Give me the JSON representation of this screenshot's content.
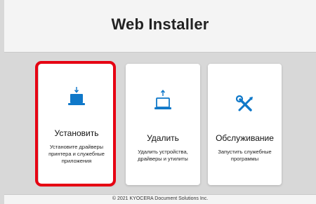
{
  "header": {
    "title": "Web Installer"
  },
  "cards": [
    {
      "title": "Установить",
      "description_lines": [
        "Установите драйверы",
        "принтера и служебные",
        "приложения"
      ],
      "icon": "laptop-download-icon"
    },
    {
      "title": "Удалить",
      "description_lines": [
        "Удалить устройства,",
        "драйверы и утилиты"
      ],
      "icon": "laptop-upload-icon"
    },
    {
      "title": "Обслуживание",
      "description_lines": [
        "Запустить служебные",
        "программы"
      ],
      "icon": "wrench-screwdriver-icon"
    }
  ],
  "selected_card": 0,
  "colors": {
    "accent_blue": "#0f78c9",
    "selection_red": "#e60012"
  },
  "footer": {
    "copyright": "© 2021 KYOCERA Document Solutions Inc."
  }
}
